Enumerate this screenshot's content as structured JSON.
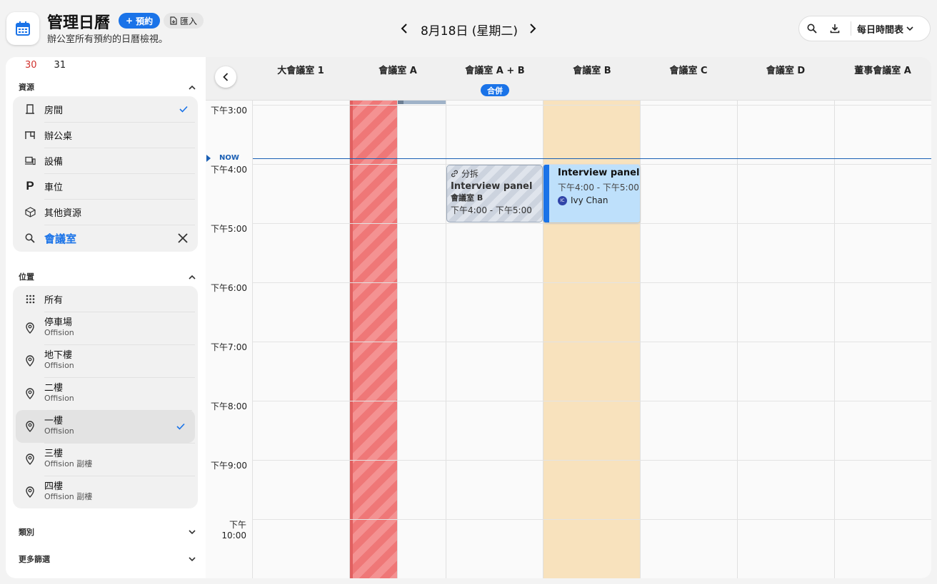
{
  "header": {
    "title": "管理日曆",
    "subtitle": "辦公室所有預約的日曆檢視。",
    "book_label": "預約",
    "import_label": "匯入",
    "date": "8月18日 (星期二)",
    "view_label": "每日時間表"
  },
  "mini_calendar": {
    "days": [
      "30",
      "31"
    ]
  },
  "resources": {
    "heading": "資源",
    "items": [
      {
        "label": "房間",
        "icon": "room-icon",
        "checked": true
      },
      {
        "label": "辦公桌",
        "icon": "desk-icon"
      },
      {
        "label": "設備",
        "icon": "devices-icon"
      },
      {
        "label": "車位",
        "icon": "parking-icon"
      },
      {
        "label": "其他資源",
        "icon": "box-icon"
      }
    ],
    "search_value": "會議室"
  },
  "locations": {
    "heading": "位置",
    "items": [
      {
        "label": "所有"
      },
      {
        "label": "停車場",
        "sub": "Offision"
      },
      {
        "label": "地下樓",
        "sub": "Offision"
      },
      {
        "label": "二樓",
        "sub": "Offision"
      },
      {
        "label": "一樓",
        "sub": "Offision",
        "selected": true
      },
      {
        "label": "三樓",
        "sub": "Offision 副樓"
      },
      {
        "label": "四樓",
        "sub": "Offision 副樓"
      }
    ]
  },
  "filters": {
    "category": "類別",
    "more": "更多篩選"
  },
  "calendar": {
    "rooms": [
      "大會議室 1",
      "會議室 A",
      "會議室 A + B",
      "會議室 B",
      "會議室 C",
      "會議室 D",
      "董事會議室 A"
    ],
    "merge_badge": "合併",
    "times": [
      "下午3:00",
      "下午4:00",
      "下午5:00",
      "下午6:00",
      "下午7:00",
      "下午8:00",
      "下午9:00",
      "下午10:00"
    ],
    "now_label": "NOW",
    "events": {
      "split": {
        "tag": "分拆",
        "title": "Interview panel",
        "room": "會議室 B",
        "time": "下午4:00 - 下午5:00"
      },
      "main": {
        "title": "Interview panel",
        "time": "下午4:00 - 下午5:00",
        "person": "Ivy Chan",
        "initials": "IC"
      }
    }
  },
  "colors": {
    "accent": "#1a73e8",
    "blocked": "#ef7777",
    "room_b_bg": "#f8e2bd",
    "event": "#bee0fb"
  }
}
